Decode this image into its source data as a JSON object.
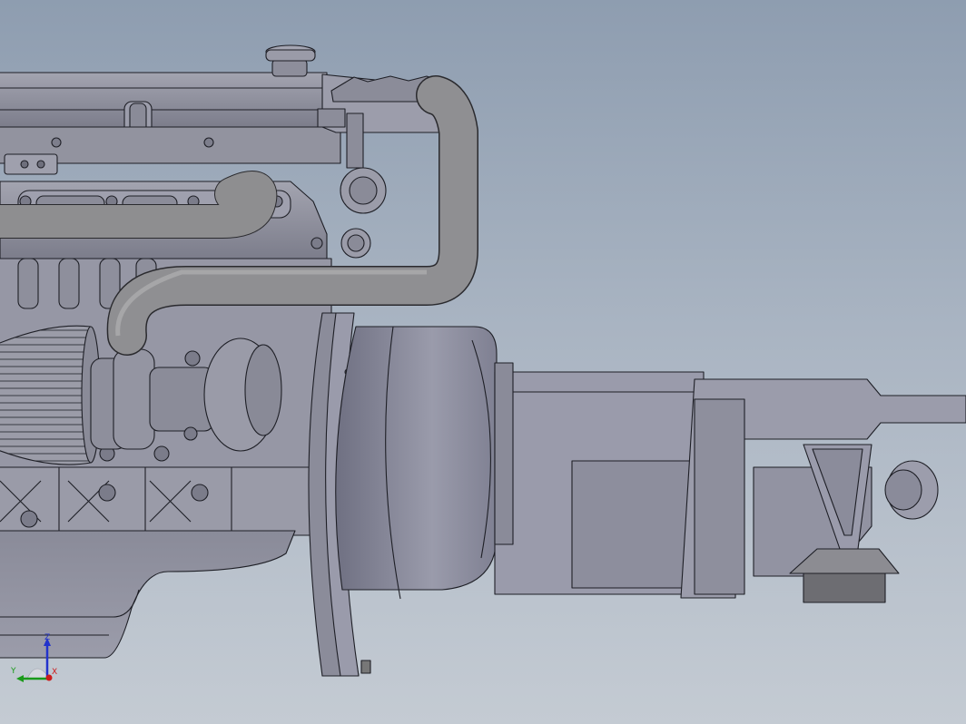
{
  "viewport": {
    "background_top": "#8e9db0",
    "background_bottom": "#c4cbd3",
    "model_color": "#8f909e",
    "edge_color": "#1e1f26",
    "content": "cad-model"
  },
  "triad": {
    "z_label": "Z",
    "y_label": "Y",
    "x_label": "X",
    "z_color": "#2233cc",
    "y_color": "#1a9a1a",
    "x_color": "#cc1a1a"
  }
}
